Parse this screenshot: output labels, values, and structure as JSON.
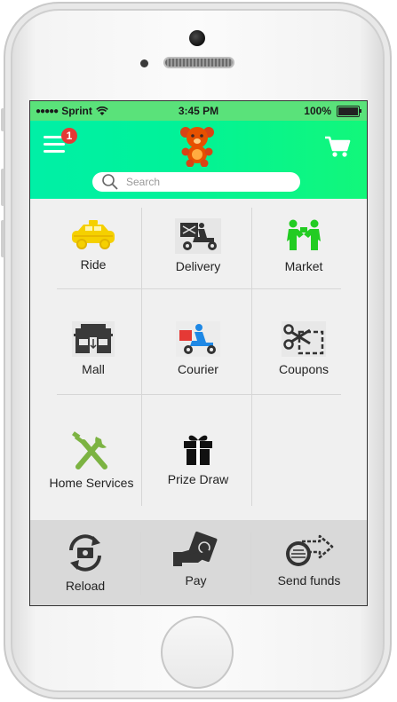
{
  "status_bar": {
    "carrier": "Sprint",
    "time": "3:45 PM",
    "battery": "100%",
    "battery_level": 1.0
  },
  "header": {
    "notification_count": "1",
    "search": {
      "placeholder": "Search"
    }
  },
  "services": [
    {
      "label": "Ride",
      "icon": "taxi-icon"
    },
    {
      "label": "Delivery",
      "icon": "delivery-scooter-icon"
    },
    {
      "label": "Market",
      "icon": "market-handshake-icon"
    },
    {
      "label": "Mall",
      "icon": "mall-storefront-icon"
    },
    {
      "label": "Courier",
      "icon": "courier-scooter-icon"
    },
    {
      "label": "Coupons",
      "icon": "scissors-coupon-icon"
    },
    {
      "label": "Home Services",
      "icon": "tools-icon"
    },
    {
      "label": "Prize Draw",
      "icon": "gift-icon"
    }
  ],
  "bottom_bar": [
    {
      "label": "Reload",
      "icon": "reload-cycle-icon"
    },
    {
      "label": "Pay",
      "icon": "pay-hand-money-icon"
    },
    {
      "label": "Send funds",
      "icon": "send-funds-coins-icon"
    }
  ],
  "colors": {
    "header_gradient_start": "#00f0a6",
    "header_gradient_end": "#12f77a",
    "status_bar": "#5ae27a",
    "badge": "#e53935",
    "taxi": "#f5d000",
    "tools": "#7cb342",
    "market": "#22cc22"
  }
}
